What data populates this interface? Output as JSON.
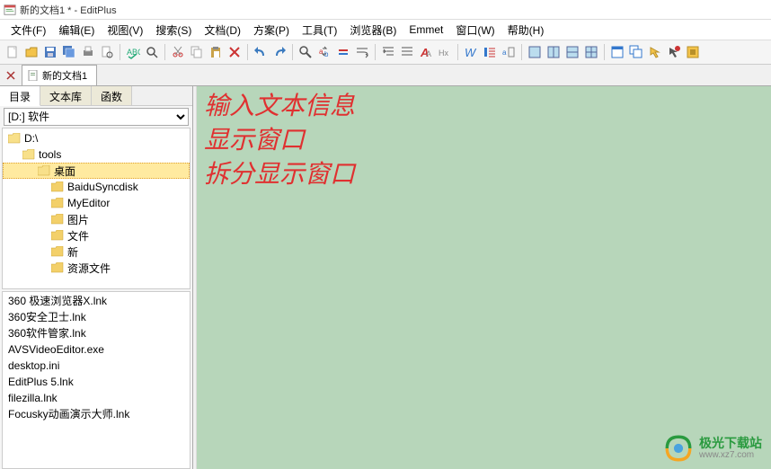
{
  "titlebar": {
    "text": "新的文档1 * - EditPlus"
  },
  "menus": [
    {
      "label": "文件(F)",
      "key": "F"
    },
    {
      "label": "编辑(E)",
      "key": "E"
    },
    {
      "label": "视图(V)",
      "key": "V"
    },
    {
      "label": "搜索(S)",
      "key": "S"
    },
    {
      "label": "文档(D)",
      "key": "D"
    },
    {
      "label": "方案(P)",
      "key": "P"
    },
    {
      "label": "工具(T)",
      "key": "T"
    },
    {
      "label": "浏览器(B)",
      "key": "B"
    },
    {
      "label": "Emmet",
      "key": ""
    },
    {
      "label": "窗口(W)",
      "key": "W"
    },
    {
      "label": "帮助(H)",
      "key": "H"
    }
  ],
  "toolbar_icons": [
    "new",
    "open",
    "save",
    "save-all",
    "print",
    "print-preview",
    "|",
    "spell",
    "find",
    "|",
    "cut",
    "copy",
    "paste",
    "delete",
    "|",
    "undo",
    "redo",
    "|",
    "search",
    "find-replace",
    "bookmark",
    "word-wrap",
    "|",
    "indent",
    "outdent",
    "font-bold",
    "hex",
    "|",
    "browser",
    "ruler",
    "column",
    "|",
    "grid1",
    "grid2",
    "grid3",
    "grid4",
    "|",
    "win1",
    "win2",
    "arrow",
    "record",
    "macro"
  ],
  "doc_tab": {
    "label": "新的文档1",
    "modified": true
  },
  "side_tabs": [
    "目录",
    "文本库",
    "函数"
  ],
  "drive": {
    "selected": "[D:] 软件"
  },
  "folders": [
    {
      "name": "D:\\",
      "depth": 0,
      "open": true
    },
    {
      "name": "tools",
      "depth": 1,
      "open": true
    },
    {
      "name": "桌面",
      "depth": 2,
      "open": true,
      "selected": true
    },
    {
      "name": "BaiduSyncdisk",
      "depth": 3
    },
    {
      "name": "MyEditor",
      "depth": 3
    },
    {
      "name": "图片",
      "depth": 3
    },
    {
      "name": "文件",
      "depth": 3
    },
    {
      "name": "新",
      "depth": 3
    },
    {
      "name": "资源文件",
      "depth": 3
    }
  ],
  "files": [
    "360 极速浏览器X.lnk",
    "360安全卫士.lnk",
    "360软件管家.lnk",
    "AVSVideoEditor.exe",
    "desktop.ini",
    "EditPlus 5.lnk",
    "filezilla.lnk",
    "Focusky动画演示大师.lnk"
  ],
  "editor_lines": [
    "输入文本信息",
    "显示窗口",
    "拆分显示窗口"
  ],
  "watermark": {
    "cn": "极光下载站",
    "en": "www.xz7.com"
  }
}
